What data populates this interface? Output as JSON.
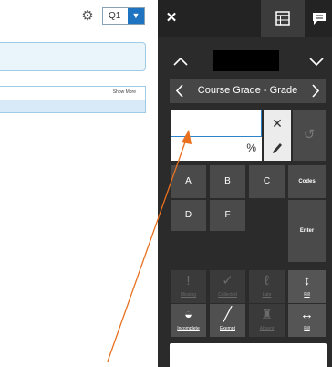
{
  "toolbar": {
    "settings_icon": "gear-icon",
    "quarter": "Q1"
  },
  "list": {
    "show_more_label": "Show More"
  },
  "panel": {
    "close_icon": "close-icon",
    "tabs": [
      "calculator-icon",
      "comment-icon"
    ],
    "student_name": "",
    "column_label": "Course Grade - Grade",
    "grade_value": "",
    "percent_symbol": "%",
    "keys": {
      "a": "A",
      "b": "B",
      "c": "C",
      "codes": "Codes",
      "d": "D",
      "f": "F",
      "enter": "Enter"
    },
    "marks": [
      {
        "label": "Missing",
        "icon": "exclamation-icon",
        "active": false
      },
      {
        "label": "Collected",
        "icon": "check-icon",
        "active": false
      },
      {
        "label": "Late",
        "icon": "late-icon",
        "active": false
      },
      {
        "label": "Fill",
        "icon": "vertical-arrows-icon",
        "active": true
      },
      {
        "label": "Incomplete",
        "icon": "half-circle-icon",
        "active": true
      },
      {
        "label": "Exempt",
        "icon": "slash-icon",
        "active": true
      },
      {
        "label": "Absent",
        "icon": "absent-icon",
        "active": false
      },
      {
        "label": "Fill",
        "icon": "horizontal-arrows-icon",
        "active": true
      }
    ]
  },
  "colors": {
    "panel_bg": "#2b2b2b",
    "accent_blue": "#1f74c2",
    "annotation_arrow": "#e8701f"
  }
}
